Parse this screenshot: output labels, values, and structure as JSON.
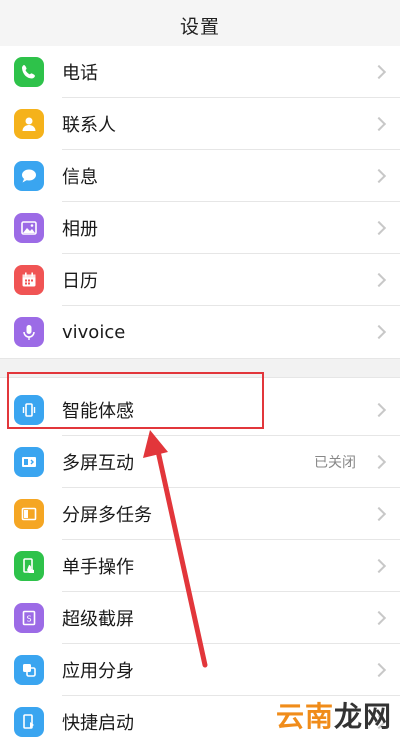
{
  "header": {
    "title": "设置"
  },
  "group1": [
    {
      "label": "电话",
      "icon": "phone-icon",
      "color": "#2ec24a"
    },
    {
      "label": "联系人",
      "icon": "contacts-icon",
      "color": "#f5b21b"
    },
    {
      "label": "信息",
      "icon": "message-icon",
      "color": "#3aa5f0"
    },
    {
      "label": "相册",
      "icon": "album-icon",
      "color": "#9c6be6"
    },
    {
      "label": "日历",
      "icon": "calendar-icon",
      "color": "#f05454"
    },
    {
      "label": "vivoice",
      "icon": "microphone-icon",
      "color": "#9c6be6"
    }
  ],
  "group2": [
    {
      "label": "智能体感",
      "icon": "phone-vibration-icon",
      "color": "#3aa5f0"
    },
    {
      "label": "多屏互动",
      "icon": "multi-screen-icon",
      "color": "#3aa5f0",
      "value": "已关闭"
    },
    {
      "label": "分屏多任务",
      "icon": "split-screen-icon",
      "color": "#f5a623"
    },
    {
      "label": "单手操作",
      "icon": "one-hand-icon",
      "color": "#2ec24a"
    },
    {
      "label": "超级截屏",
      "icon": "screenshot-icon",
      "color": "#9c6be6"
    },
    {
      "label": "应用分身",
      "icon": "app-clone-icon",
      "color": "#3aa5f0"
    },
    {
      "label": "快捷启动",
      "icon": "quick-launch-icon",
      "color": "#3aa5f0"
    }
  ],
  "annotation": {
    "highlighted_item": "智能体感",
    "highlight_color": "#e2363b"
  },
  "watermark": {
    "text_main": "云南",
    "text_last": "龙网"
  }
}
